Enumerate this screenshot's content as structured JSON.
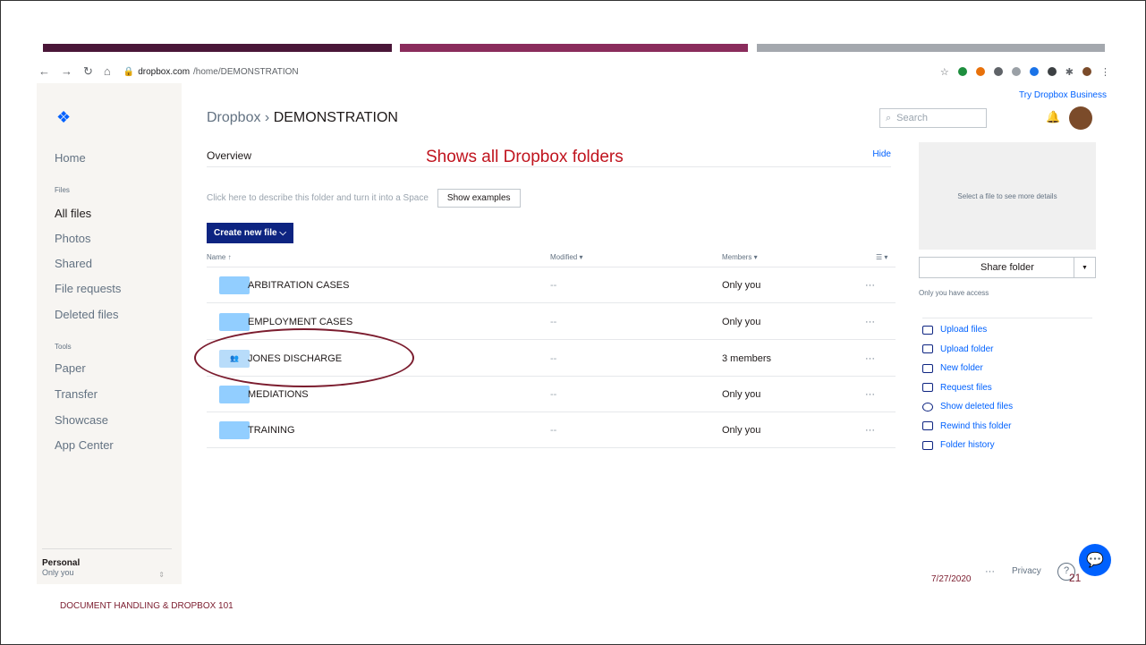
{
  "browser": {
    "url_host": "dropbox.com",
    "url_path": "/home/DEMONSTRATION"
  },
  "sidebar": {
    "items": [
      {
        "label": "Home"
      },
      {
        "label": "All files"
      },
      {
        "label": "Photos"
      },
      {
        "label": "Shared"
      },
      {
        "label": "File requests"
      },
      {
        "label": "Deleted files"
      },
      {
        "label": "Paper"
      },
      {
        "label": "Transfer"
      },
      {
        "label": "Showcase"
      },
      {
        "label": "App Center"
      }
    ],
    "section_files": "Files",
    "section_tools": "Tools",
    "account_name": "Personal",
    "account_sub": "Only you"
  },
  "header": {
    "crumb_root": "Dropbox",
    "crumb_sep": " › ",
    "crumb_current": "DEMONSTRATION",
    "try_business": "Try Dropbox Business",
    "search_placeholder": "Search"
  },
  "overview": {
    "title": "Overview",
    "hide": "Hide",
    "annotation": "Shows all Dropbox folders",
    "describe_text": "Click here to describe this folder and turn it into a Space",
    "show_examples": "Show examples",
    "create_label": "Create new file ⌵"
  },
  "table": {
    "headers": {
      "name": "Name ↑",
      "modified": "Modified ▾",
      "members": "Members ▾",
      "view": "☰ ▾"
    },
    "rows": [
      {
        "name": "ARBITRATION CASES",
        "modified": "--",
        "members": "Only you",
        "more": "···",
        "shared": false
      },
      {
        "name": "EMPLOYMENT CASES",
        "modified": "--",
        "members": "Only you",
        "more": "···",
        "shared": false
      },
      {
        "name": "JONES DISCHARGE",
        "modified": "--",
        "members": "3 members",
        "more": "···",
        "shared": true
      },
      {
        "name": "MEDIATIONS",
        "modified": "--",
        "members": "Only you",
        "more": "···",
        "shared": false
      },
      {
        "name": "TRAINING",
        "modified": "--",
        "members": "Only you",
        "more": "···",
        "shared": false
      }
    ]
  },
  "details": {
    "placeholder": "Select a file to see more details",
    "share_folder": "Share folder",
    "access": "Only you have access",
    "actions": [
      {
        "label": "Upload files"
      },
      {
        "label": "Upload folder"
      },
      {
        "label": "New folder"
      },
      {
        "label": "Request files"
      },
      {
        "label": "Show deleted files"
      },
      {
        "label": "Rewind this folder"
      },
      {
        "label": "Folder history"
      }
    ]
  },
  "slide": {
    "footer_text": "DOCUMENT HANDLING & DROPBOX 101",
    "date": "7/27/2020",
    "page_number": "21",
    "privacy": "Privacy",
    "more": "···",
    "help": "?"
  },
  "colors": {
    "accent": "#0061fe",
    "slide_accent": "#7b1c2e",
    "annotation": "#c0141e"
  }
}
